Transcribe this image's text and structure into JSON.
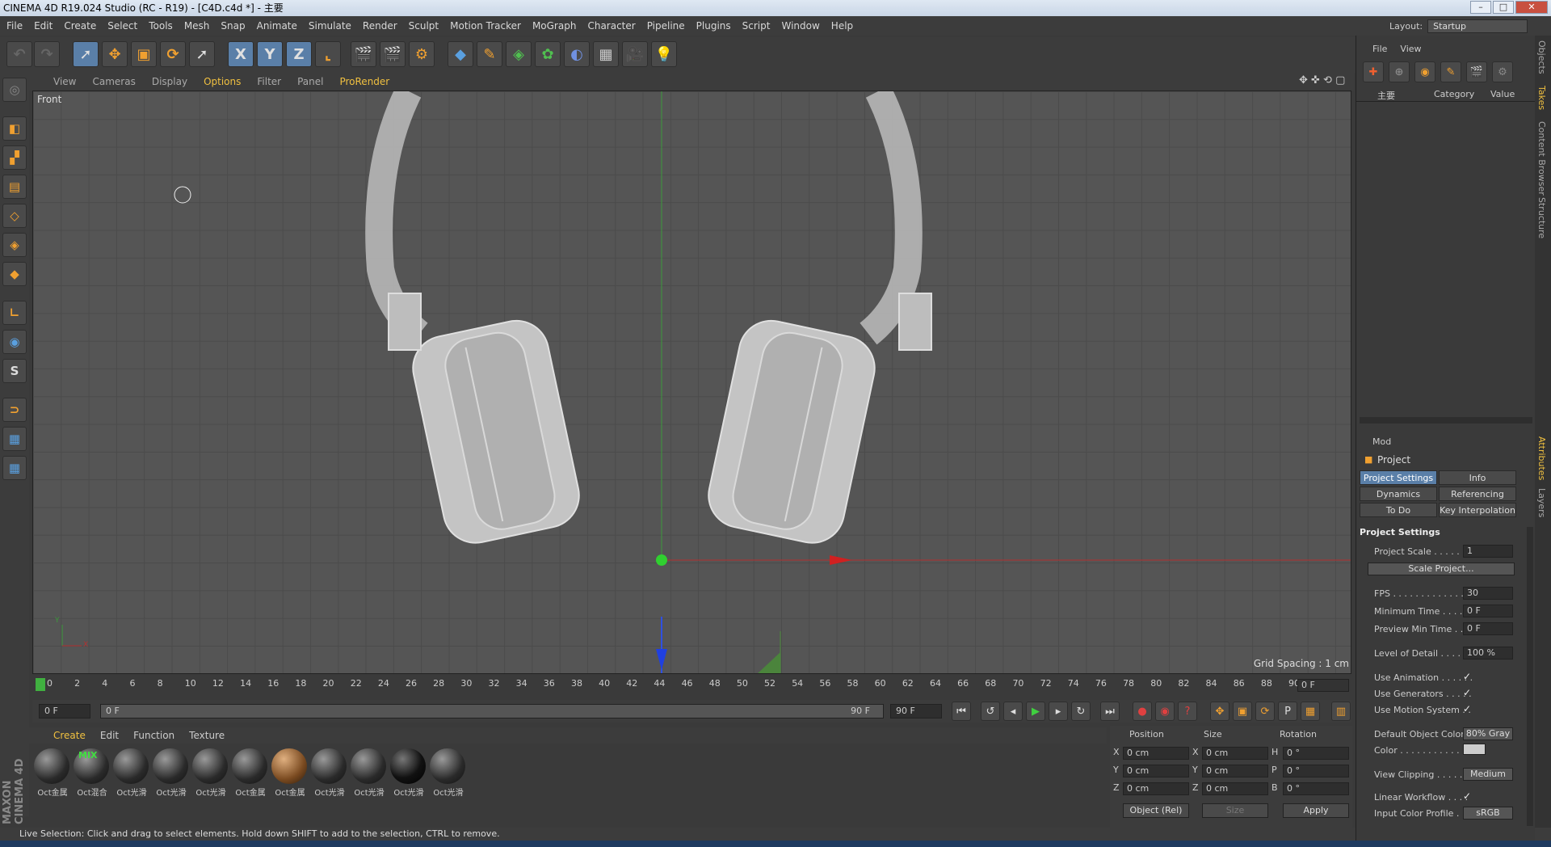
{
  "window": {
    "title": "CINEMA 4D R19.024 Studio (RC - R19) - [C4D.c4d *] - 主要",
    "min": "–",
    "max": "□",
    "close": "✕"
  },
  "menu": [
    "File",
    "Edit",
    "Create",
    "Select",
    "Tools",
    "Mesh",
    "Snap",
    "Animate",
    "Simulate",
    "Render",
    "Sculpt",
    "Motion Tracker",
    "MoGraph",
    "Character",
    "Pipeline",
    "Plugins",
    "Script",
    "Window",
    "Help"
  ],
  "layout": {
    "label": "Layout:",
    "value": "Startup"
  },
  "viewport": {
    "menu": [
      "View",
      "Cameras",
      "Display",
      "Options",
      "Filter",
      "Panel",
      "ProRender"
    ],
    "active_menu": "Options",
    "name": "Front",
    "grid_spacing": "Grid Spacing : 1 cm",
    "axis_y": "Y",
    "axis_x": "X"
  },
  "timeline": {
    "ticks": [
      "0",
      "2",
      "4",
      "6",
      "8",
      "10",
      "12",
      "14",
      "16",
      "18",
      "20",
      "22",
      "24",
      "26",
      "28",
      "30",
      "32",
      "34",
      "36",
      "38",
      "40",
      "42",
      "44",
      "46",
      "48",
      "50",
      "52",
      "54",
      "56",
      "58",
      "60",
      "62",
      "64",
      "66",
      "68",
      "70",
      "72",
      "74",
      "76",
      "78",
      "80",
      "82",
      "84",
      "86",
      "88",
      "90"
    ],
    "current": "0 F",
    "start": "0 F",
    "range_start": "0 F",
    "range_end": "90 F",
    "end": "90 F",
    "end2": "0 F"
  },
  "materials": {
    "menu": [
      "Create",
      "Edit",
      "Function",
      "Texture"
    ],
    "items": [
      "Oct金属",
      "Oct混合",
      "Oct光滑",
      "Oct光滑",
      "Oct光滑",
      "Oct金属",
      "Oct金属",
      "Oct光滑",
      "Oct光滑",
      "Oct光滑",
      "Oct光滑"
    ],
    "mix_label": "MIX"
  },
  "coords": {
    "headers": [
      "Position",
      "Size",
      "Rotation"
    ],
    "rows": [
      {
        "a1": "X",
        "v1": "0 cm",
        "a2": "X",
        "v2": "0 cm",
        "a3": "H",
        "v3": "0 °"
      },
      {
        "a1": "Y",
        "v1": "0 cm",
        "a2": "Y",
        "v2": "0 cm",
        "a3": "P",
        "v3": "0 °"
      },
      {
        "a1": "Z",
        "v1": "0 cm",
        "a2": "Z",
        "v2": "0 cm",
        "a3": "B",
        "v3": "0 °"
      }
    ],
    "mode": "Object (Rel)",
    "size_mode": "Size",
    "apply": "Apply"
  },
  "status": "Live Selection: Click and drag to select elements. Hold down SHIFT to add to the selection, CTRL to remove.",
  "object_manager": {
    "menu": [
      "File",
      "View"
    ],
    "take": "主要",
    "col_category": "Category",
    "col_value": "Value"
  },
  "attributes": {
    "mode": "Mod",
    "title": "Project",
    "tabs": [
      "Project Settings",
      "Info",
      "Dynamics",
      "Referencing",
      "To Do",
      "Key Interpolation"
    ],
    "section": "Project Settings",
    "rows": [
      {
        "label": "Project Scale . . . . . .",
        "value": "1"
      },
      {
        "label": "FPS . . . . . . . . . . . . . .",
        "value": "30"
      },
      {
        "label": "Minimum Time . . . . . .",
        "value": "0 F"
      },
      {
        "label": "Preview Min Time . . . .",
        "value": "0 F"
      },
      {
        "label": "Level of Detail . . . . . .",
        "value": "100 %"
      }
    ],
    "scale_button": "Scale Project...",
    "checks": [
      {
        "label": "Use Animation . . . . . .",
        "mark": "✓"
      },
      {
        "label": "Use Generators . . . . .",
        "mark": "✓"
      },
      {
        "label": "Use Motion System . .",
        "mark": "✓"
      }
    ],
    "default_color_label": "Default Object Color",
    "default_color_value": "80% Gray",
    "color_label": "Color . . . . . . . . . . .",
    "view_clipping_label": "View Clipping . . . . . .",
    "view_clipping_value": "Medium",
    "linear_label": "Linear Workflow . . . .",
    "linear_mark": "✓",
    "input_profile_label": "Input Color Profile . .",
    "input_profile_value": "sRGB"
  },
  "side_tabs": [
    "Objects",
    "Takes",
    "Content Browser",
    "Structure",
    "Attributes",
    "Layers"
  ],
  "brand": "MAXON CINEMA 4D"
}
